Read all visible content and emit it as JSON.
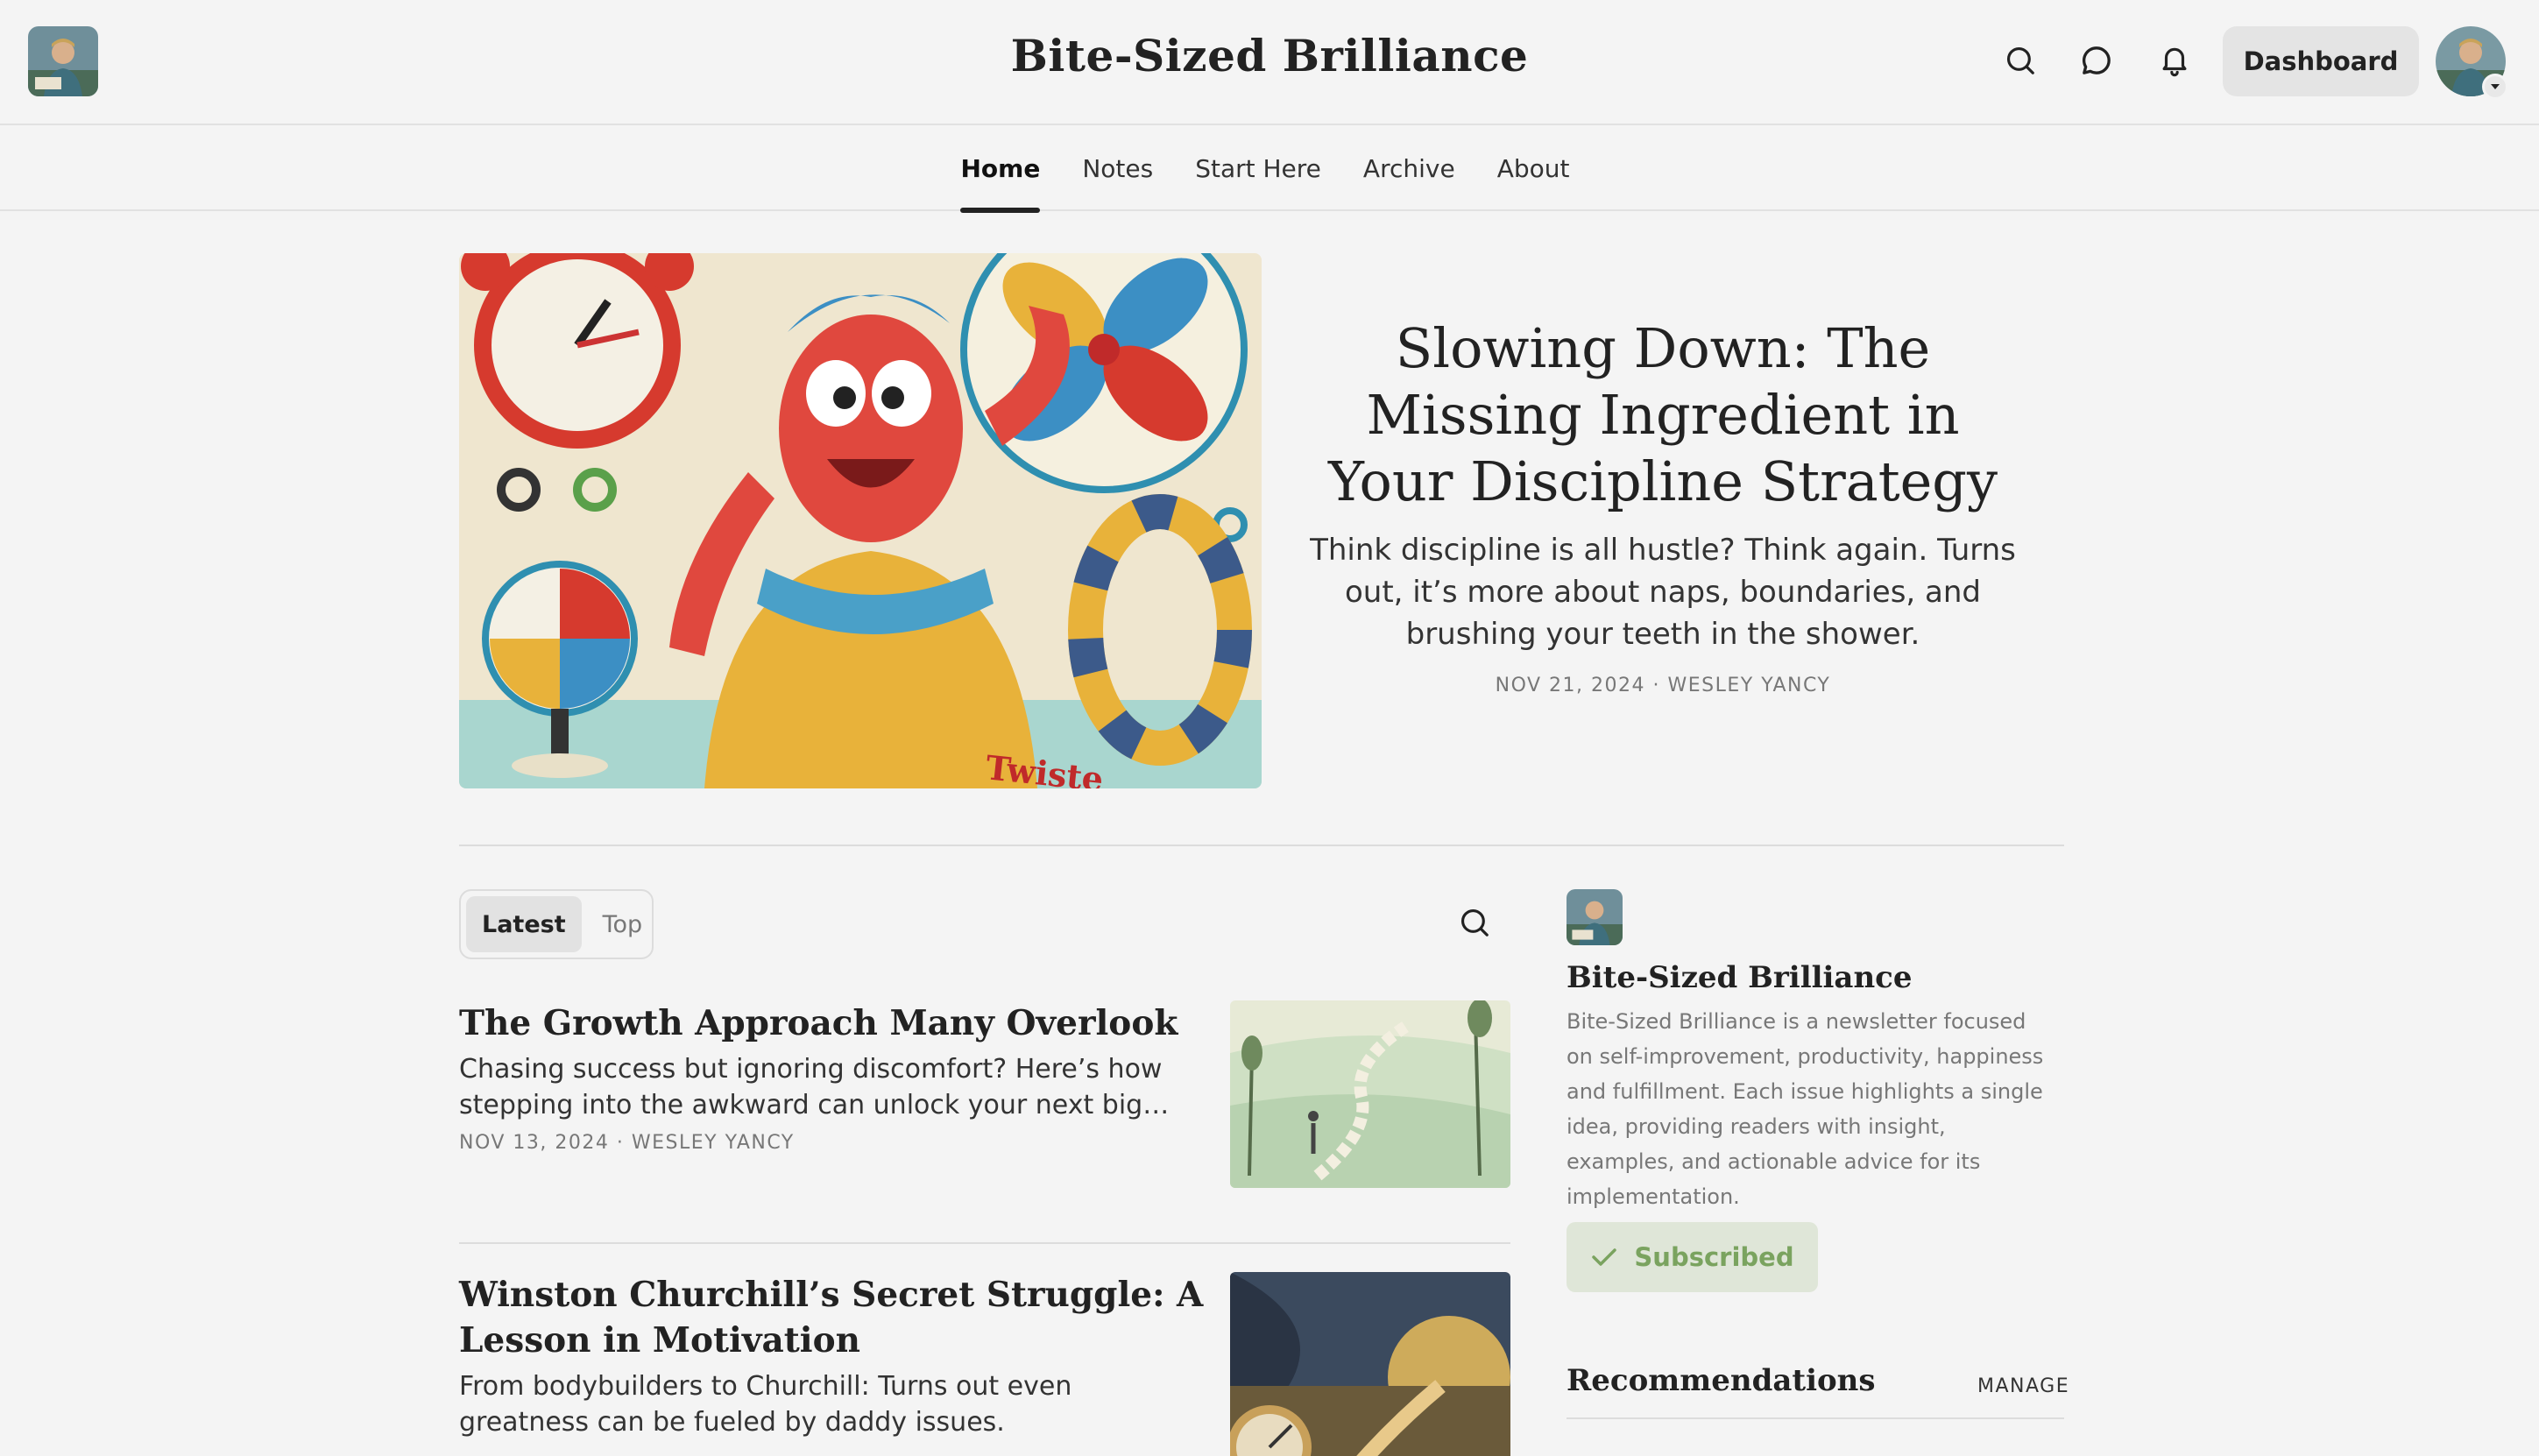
{
  "header": {
    "site_title": "Bite-Sized Brilliance",
    "dashboard_label": "Dashboard",
    "icons": [
      "search-icon",
      "chat-icon",
      "bell-icon",
      "chevron-down-icon"
    ]
  },
  "nav": {
    "items": [
      {
        "label": "Home",
        "active": true
      },
      {
        "label": "Notes",
        "active": false
      },
      {
        "label": "Start Here",
        "active": false
      },
      {
        "label": "Archive",
        "active": false
      },
      {
        "label": "About",
        "active": false
      }
    ]
  },
  "hero": {
    "title": "Slowing Down: The Missing Ingredient in Your Discipline Strategy",
    "subtitle": "Think discipline is all hustle? Think again. Turns out, it’s more about naps, boundaries, and brushing your teeth in the shower.",
    "meta": "NOV 21, 2024 · WESLEY YANCY"
  },
  "tabs": [
    {
      "label": "Latest",
      "active": true
    },
    {
      "label": "Top",
      "active": false
    }
  ],
  "posts": [
    {
      "title": "The Growth Approach Many Overlook",
      "description": "Chasing success but ignoring discomfort? Here’s how stepping into the awkward can unlock your next big…",
      "meta": "NOV 13, 2024 · WESLEY YANCY"
    },
    {
      "title": "Winston Churchill’s Secret Struggle: A Lesson in Motivation",
      "description": "From bodybuilders to Churchill: Turns out even greatness can be fueled by daddy issues.",
      "meta": ""
    }
  ],
  "sidebar": {
    "name": "Bite-Sized Brilliance",
    "description": "Bite-Sized Brilliance is a newsletter focused on self-improvement, productivity, happiness and fulfillment. Each issue highlights a single idea, providing readers with insight, examples, and actionable advice for its implementation.",
    "subscribed_label": "Subscribed",
    "recommendations_title": "Recommendations",
    "manage_label": "MANAGE"
  },
  "colors": {
    "background": "#f4f4f4",
    "subscribed_bg": "#dfe6d8",
    "subscribed_text": "#7aa35f"
  }
}
